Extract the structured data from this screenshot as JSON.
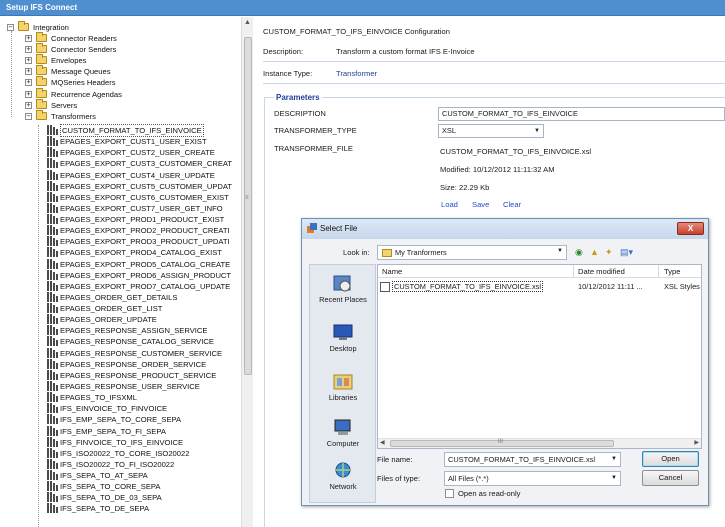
{
  "window": {
    "title": "Setup IFS Connect"
  },
  "tree": {
    "root": "Integration",
    "groups": [
      "Connector Readers",
      "Connector Senders",
      "Envelopes",
      "Message Queues",
      "MQSeries Headers",
      "Recurrence Agendas",
      "Servers",
      "Transformers"
    ],
    "transformers": [
      "CUSTOM_FORMAT_TO_IFS_EINVOICE",
      "EPAGES_EXPORT_CUST1_USER_EXIST",
      "EPAGES_EXPORT_CUST2_USER_CREATE",
      "EPAGES_EXPORT_CUST3_CUSTOMER_CREAT",
      "EPAGES_EXPORT_CUST4_USER_UPDATE",
      "EPAGES_EXPORT_CUST5_CUSTOMER_UPDAT",
      "EPAGES_EXPORT_CUST6_CUSTOMER_EXIST",
      "EPAGES_EXPORT_CUST7_USER_GET_INFO",
      "EPAGES_EXPORT_PROD1_PRODUCT_EXIST",
      "EPAGES_EXPORT_PROD2_PRODUCT_CREATI",
      "EPAGES_EXPORT_PROD3_PRODUCT_UPDATI",
      "EPAGES_EXPORT_PROD4_CATALOG_EXIST",
      "EPAGES_EXPORT_PROD5_CATALOG_CREATE",
      "EPAGES_EXPORT_PROD6_ASSIGN_PRODUCT",
      "EPAGES_EXPORT_PROD7_CATALOG_UPDATE",
      "EPAGES_ORDER_GET_DETAILS",
      "EPAGES_ORDER_GET_LIST",
      "EPAGES_ORDER_UPDATE",
      "EPAGES_RESPONSE_ASSIGN_SERVICE",
      "EPAGES_RESPONSE_CATALOG_SERVICE",
      "EPAGES_RESPONSE_CUSTOMER_SERVICE",
      "EPAGES_RESPONSE_ORDER_SERVICE",
      "EPAGES_RESPONSE_PRODUCT_SERVICE",
      "EPAGES_RESPONSE_USER_SERVICE",
      "EPAGES_TO_IFSXML",
      "IFS_EINVOICE_TO_FINVOICE",
      "IFS_EMP_SEPA_TO_CORE_SEPA",
      "IFS_EMP_SEPA_TO_FI_SEPA",
      "IFS_FINVOICE_TO_IFS_EINVOICE",
      "IFS_ISO20022_TO_CORE_ISO20022",
      "IFS_ISO20022_TO_FI_ISO20022",
      "IFS_SEPA_TO_AT_SEPA",
      "IFS_SEPA_TO_CORE_SEPA",
      "IFS_SEPA_TO_DE_03_SEPA",
      "IFS_SEPA_TO_DE_SEPA"
    ]
  },
  "config": {
    "heading": "CUSTOM_FORMAT_TO_IFS_EINVOICE Configuration",
    "description_label": "Description:",
    "description_value": "Transform a custom format IFS E-Invoice",
    "instance_type_label": "Instance Type:",
    "instance_type_value": "Transformer",
    "parameters_title": "Parameters",
    "description_param_label": "DESCRIPTION",
    "description_param_value": "CUSTOM_FORMAT_TO_IFS_EINVOICE",
    "transformer_type_label": "TRANSFORMER_TYPE",
    "transformer_type_value": "XSL",
    "transformer_file_label": "TRANSFORMER_FILE",
    "transformer_file_value": "CUSTOM_FORMAT_TO_IFS_EINVOICE.xsl",
    "modified": "Modified: 10/12/2012 11:11:32 AM",
    "size": "Size: 22.29 Kb",
    "links": {
      "load": "Load",
      "save": "Save",
      "clear": "Clear"
    }
  },
  "dialog": {
    "title": "Select File",
    "close_label": "X",
    "look_in_label": "Look in:",
    "look_in_value": "My Tranformers",
    "places": [
      "Recent Places",
      "Desktop",
      "Libraries",
      "Computer",
      "Network"
    ],
    "columns": {
      "name": "Name",
      "date": "Date modified",
      "type": "Type"
    },
    "files": [
      {
        "name": "CUSTOM_FORMAT_TO_IFS_EINVOICE.xsl",
        "date": "10/12/2012 11:11 ...",
        "type": "XSL Styles"
      }
    ],
    "file_name_label": "File name:",
    "file_name_value": "CUSTOM_FORMAT_TO_IFS_EINVOICE.xsl",
    "files_of_type_label": "Files of type:",
    "files_of_type_value": "All Files (*.*)",
    "open_button": "Open",
    "cancel_button": "Cancel",
    "read_only_label": "Open as read-only",
    "scroll_grip": "III"
  }
}
